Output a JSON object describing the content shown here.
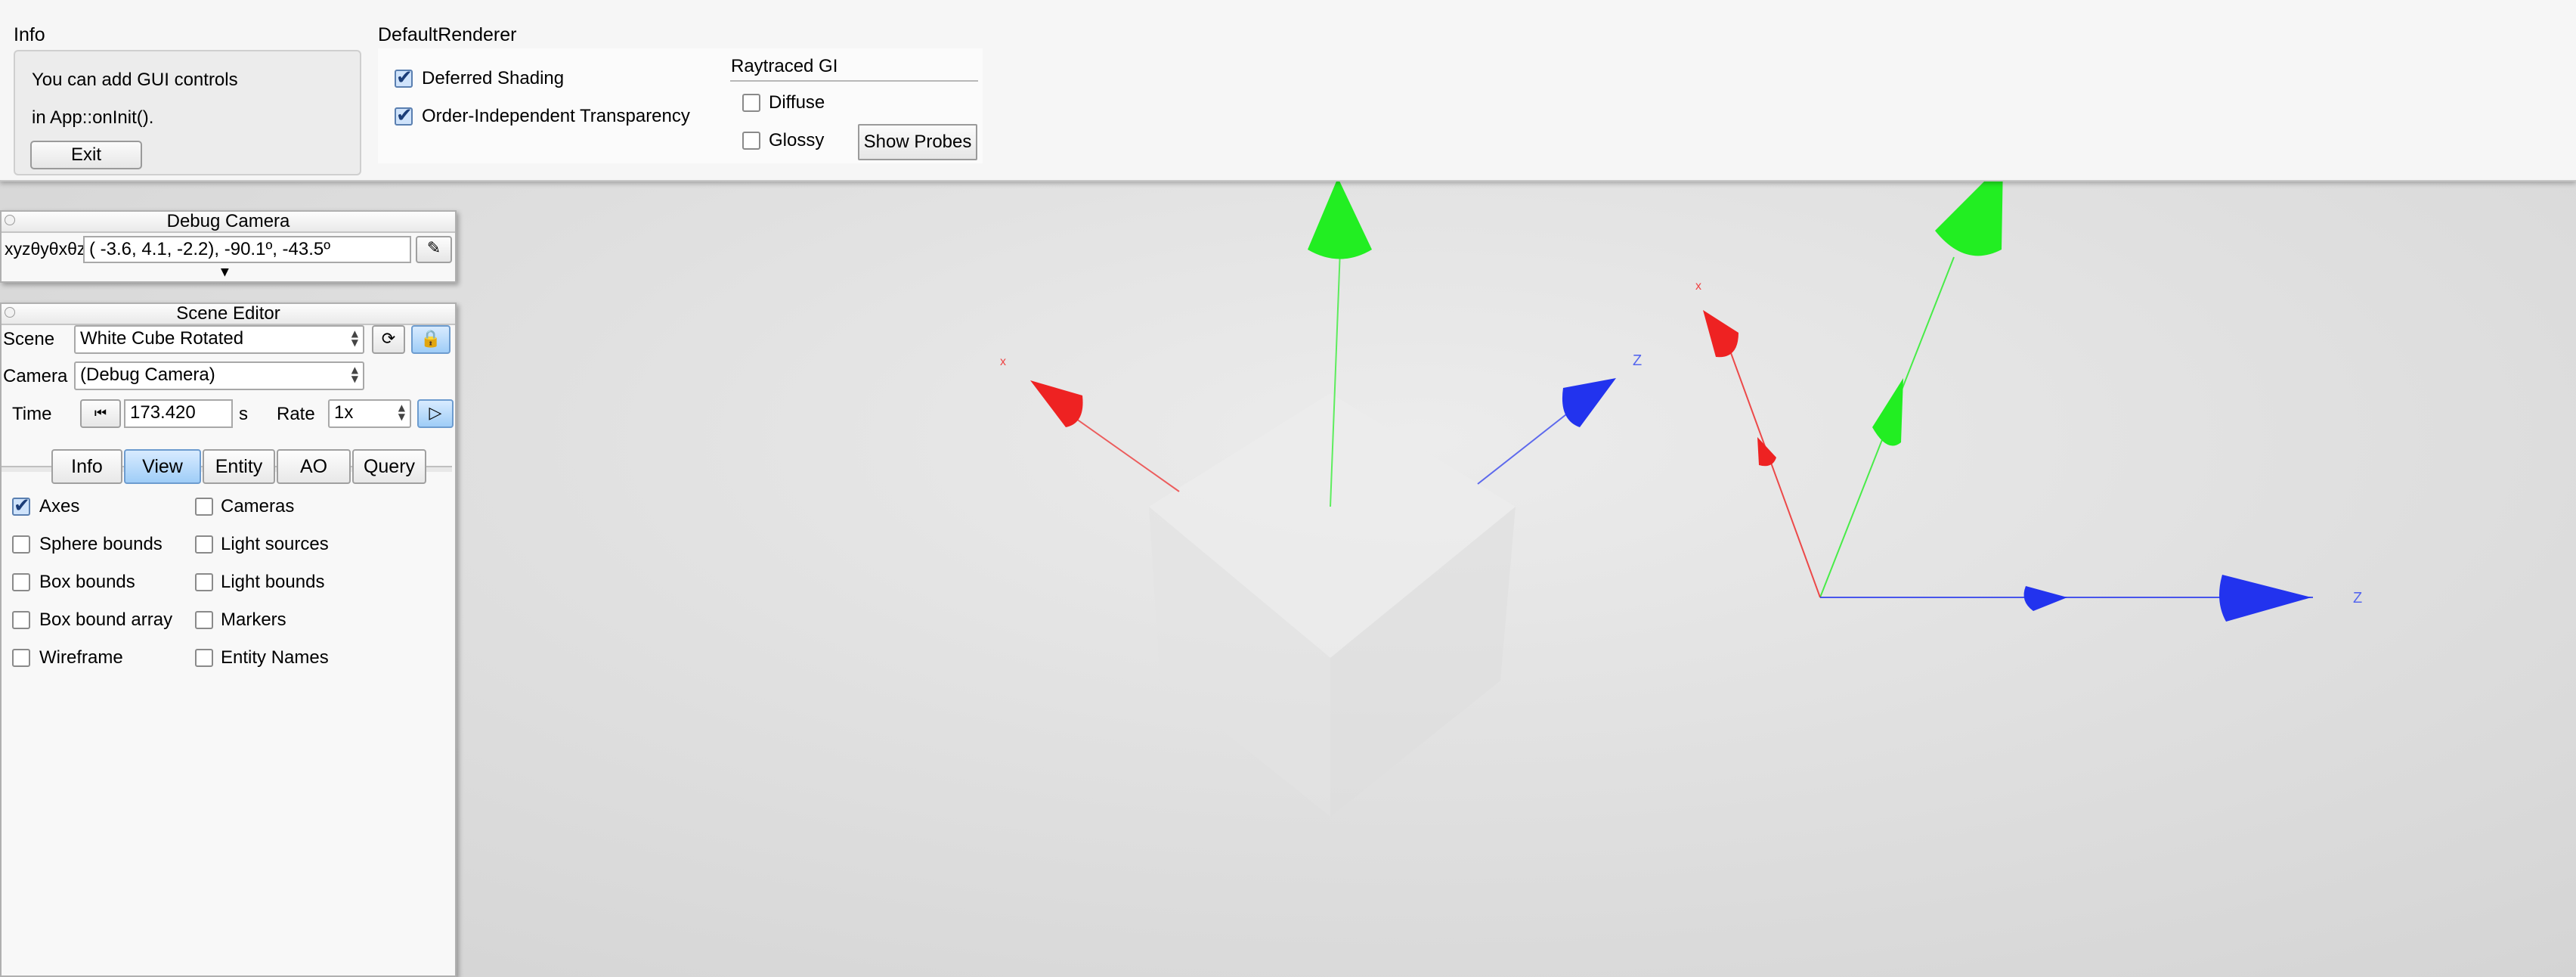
{
  "info": {
    "title": "Info",
    "text_line1": "You can add GUI controls",
    "text_line2": "in App::onInit().",
    "exit_label": "Exit"
  },
  "renderer": {
    "title": "DefaultRenderer",
    "deferred_shading": {
      "label": "Deferred Shading",
      "checked": true
    },
    "oit": {
      "label": "Order-Independent Transparency",
      "checked": true
    },
    "raytraced_gi": {
      "title": "Raytraced GI",
      "diffuse": {
        "label": "Diffuse",
        "checked": false
      },
      "glossy": {
        "label": "Glossy",
        "checked": false
      },
      "show_probes_label": "Show Probes"
    }
  },
  "debug_camera": {
    "title": "Debug Camera",
    "coord_label": "xyzθyθxθz",
    "value": "( -3.6,   4.1,  -2.2), -90.1º, -43.5º"
  },
  "scene_editor": {
    "title": "Scene Editor",
    "scene_label": "Scene",
    "scene_value": "White Cube Rotated",
    "camera_label": "Camera",
    "camera_value": "(Debug Camera)",
    "time_label": "Time",
    "time_value": "173.420",
    "time_unit": "s",
    "rate_label": "Rate",
    "rate_value": "1x",
    "tabs": [
      "Info",
      "View",
      "Entity",
      "AO",
      "Query"
    ],
    "active_tab": "View",
    "view_options_left": [
      {
        "label": "Axes",
        "checked": true
      },
      {
        "label": "Sphere bounds",
        "checked": false
      },
      {
        "label": "Box bounds",
        "checked": false
      },
      {
        "label": "Box bound array",
        "checked": false
      },
      {
        "label": "Wireframe",
        "checked": false
      }
    ],
    "view_options_right": [
      {
        "label": "Cameras",
        "checked": false
      },
      {
        "label": "Light sources",
        "checked": false
      },
      {
        "label": "Light bounds",
        "checked": false
      },
      {
        "label": "Markers",
        "checked": false
      },
      {
        "label": "Entity Names",
        "checked": false
      }
    ]
  },
  "viewport": {
    "axis_labels": {
      "x": "x",
      "z": "Z"
    },
    "colors": {
      "x_axis": "#ee2222",
      "y_axis": "#22ee22",
      "z_axis": "#2233ee"
    }
  }
}
